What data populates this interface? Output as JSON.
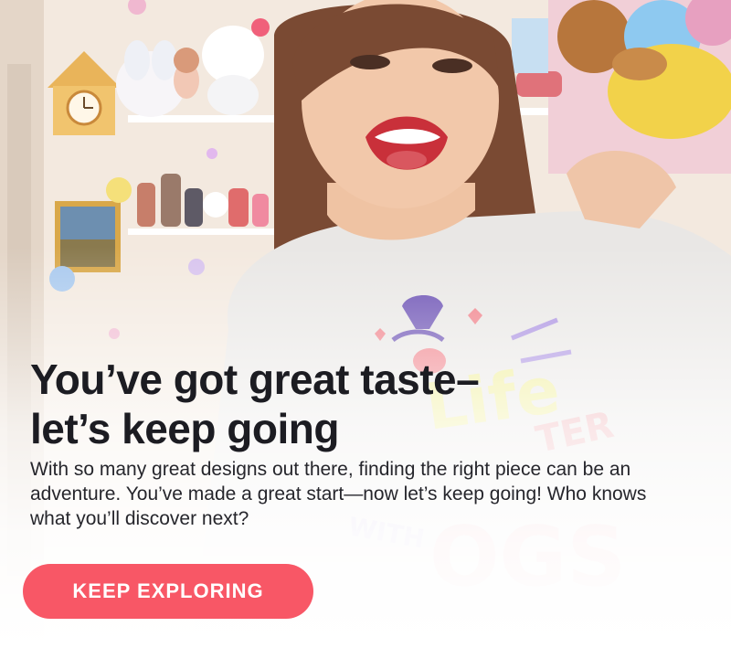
{
  "hero": {
    "headline": "You’ve got great taste– let’s keep going",
    "body": "With so many great designs out there, finding the right piece can be an adventure. You’ve made a great start—now let’s keep going! Who knows what you’ll discover next?",
    "cta_label": "KEEP EXPLORING"
  },
  "colors": {
    "cta_background": "#f85766",
    "cta_text": "#ffffff",
    "headline": "#1c1c22",
    "body_text": "#26262c"
  }
}
